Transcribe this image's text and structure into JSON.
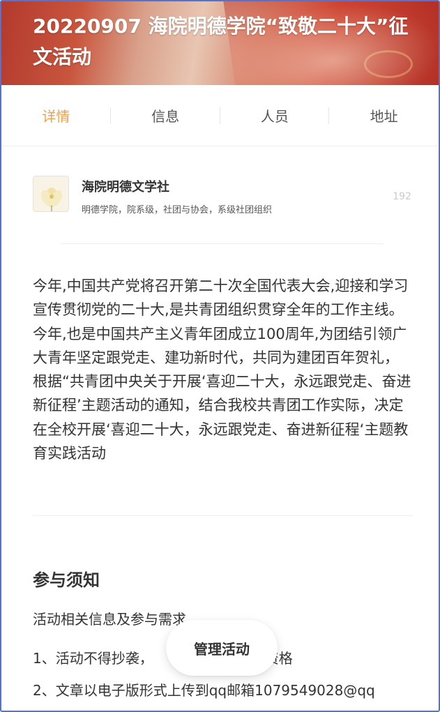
{
  "header": {
    "title": "20220907 海院明德学院“致敬二十大”征文活动"
  },
  "tabs": [
    {
      "label": "详情",
      "active": true
    },
    {
      "label": "信息",
      "active": false
    },
    {
      "label": "人员",
      "active": false
    },
    {
      "label": "地址",
      "active": false
    }
  ],
  "organization": {
    "name": "海院明德文学社",
    "tags": "明德学院，院系级，社团与协会，系级社团组织",
    "count": "192"
  },
  "description": "今年,中国共产党将召开第二十次全国代表大会,迎接和学习宣传贯彻党的二十大,是共青团组织贯穿全年的工作主线。今年,也是中国共产主义青年团成立100周年,为团结引领广大青年坚定跟党走、建功新时代，共同为建团百年贺礼，根据“共青团中央关于开展‘喜迎二十大，永远跟党走、奋进新征程’主题活动的通知，结合我校共青团工作实际，决定在全校开展‘喜迎二十大，永远跟党走、奋进新征程‘主题教育实践活动",
  "notice": {
    "title": "参与须知",
    "subtitle": "活动相关信息及参与需求",
    "line1": "1、活动不得抄袭，",
    "line1_tail": "消资格",
    "line2": "2、文章以电子版形式上传到qq邮箱1079549028@qq"
  },
  "fab": {
    "label": "管理活动"
  },
  "colors": {
    "accent": "#f0a04b",
    "frame": "#4f74d6"
  }
}
